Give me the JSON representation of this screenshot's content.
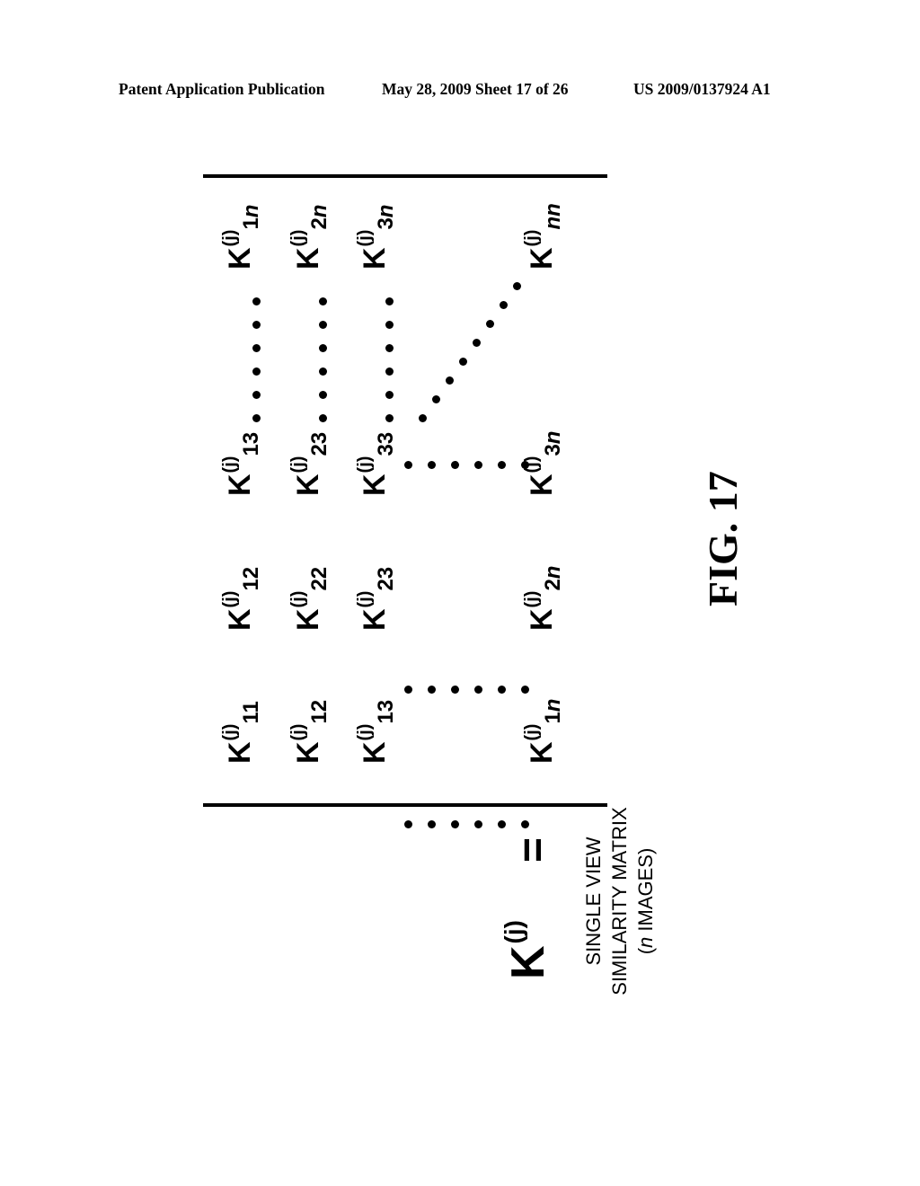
{
  "header": {
    "publication": "Patent Application Publication",
    "date_sheet": "May 28, 2009  Sheet 17 of 26",
    "number": "US 2009/0137924 A1"
  },
  "figure": {
    "label": "FIG. 17",
    "lhs": {
      "base": "K",
      "superscript": "(j)",
      "equals": "="
    },
    "caption": {
      "line1": "SINGLE VIEW",
      "line2": "SIMILARITY MATRIX",
      "line3_open": "(",
      "line3_italic": "n",
      "line3_rest": " IMAGES)"
    },
    "matrix": {
      "base": "K",
      "superscript": "(j)",
      "rows": [
        [
          "11",
          "12",
          "13",
          "1n"
        ],
        [
          "12",
          "22",
          "23",
          "2n"
        ],
        [
          "13",
          "23",
          "33",
          "3n"
        ],
        [
          "1n",
          "2n",
          "3n",
          "nn"
        ]
      ],
      "row_labels_visible": [
        [
          "11",
          "12",
          "13",
          "1n"
        ],
        [
          "12",
          "22",
          "23",
          "2n"
        ],
        [
          "13",
          "23",
          "33",
          "3n"
        ],
        [
          "1n",
          "2n",
          "3n",
          "nn"
        ]
      ],
      "ellipsis_dots_per_run": 6,
      "diagonal_dots": 8
    }
  }
}
